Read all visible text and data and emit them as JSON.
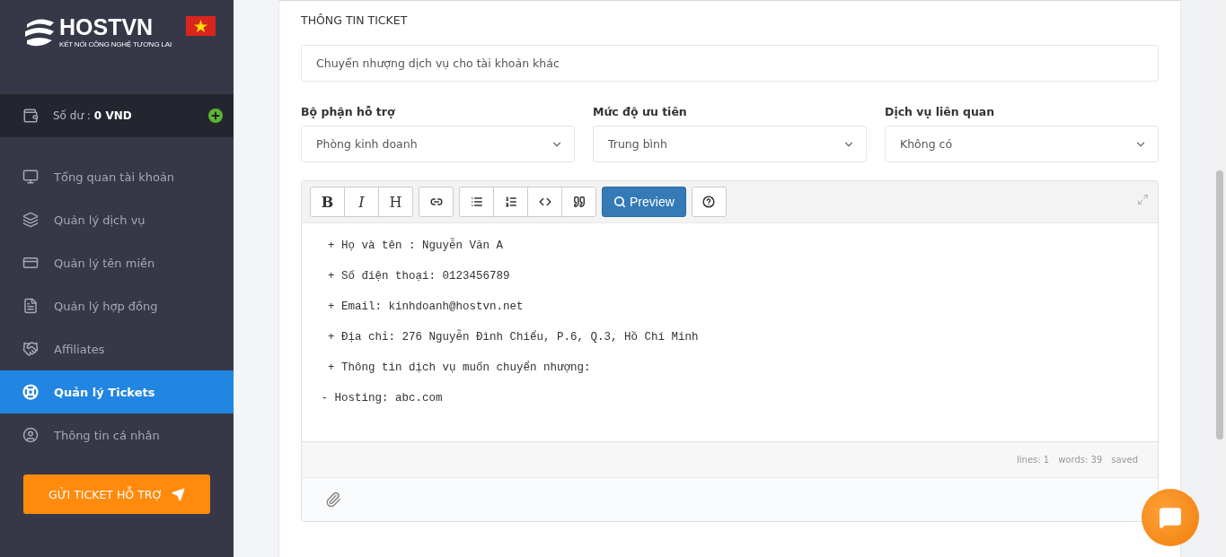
{
  "sidebar": {
    "logo": {
      "name": "HOSTVN",
      "tagline": "KẾT NỐI CÔNG NGHỆ TƯƠNG LAI"
    },
    "balance": {
      "label": "Số dư :",
      "value": "0 VND"
    },
    "items": [
      {
        "label": "Tổng quan tài khoản",
        "selected": false
      },
      {
        "label": "Quản lý dịch vụ",
        "selected": false
      },
      {
        "label": "Quản lý tên miền",
        "selected": false
      },
      {
        "label": "Quản lý hợp đồng",
        "selected": false
      },
      {
        "label": "Affiliates",
        "selected": false
      },
      {
        "label": "Quản lý Tickets",
        "selected": true
      },
      {
        "label": "Thông tin cá nhân",
        "selected": false
      }
    ],
    "cta": "GỬI TICKET HỖ TRỢ"
  },
  "form": {
    "section_title": "THÔNG TIN TICKET",
    "subject": "Chuyển nhượng dịch vụ cho tài khoản khác",
    "selects": [
      {
        "label": "Bộ phận hỗ trợ",
        "value": "Phòng kinh doanh"
      },
      {
        "label": "Mức độ ưu tiên",
        "value": "Trung bình"
      },
      {
        "label": "Dịch vụ liên quan",
        "value": "Không có"
      }
    ],
    "editor": {
      "toolbar": [
        [
          {
            "kind": "bold",
            "label": "B"
          },
          {
            "kind": "italic",
            "label": "I"
          },
          {
            "kind": "heading",
            "label": "H"
          }
        ],
        [
          {
            "kind": "link"
          }
        ],
        [
          {
            "kind": "bullets"
          },
          {
            "kind": "numbered"
          },
          {
            "kind": "code"
          },
          {
            "kind": "quote"
          }
        ],
        [
          {
            "kind": "preview",
            "label": "Preview"
          }
        ],
        [
          {
            "kind": "help"
          }
        ]
      ],
      "lines": [
        "  + Họ và tên : Nguyễn Văn A",
        "  + Số điện thoại: 0123456789",
        "  + Email: kinhdoanh@hostvn.net",
        "  + Địa chỉ: 276 Nguyễn Đình Chiểu, P.6, Q.3, Hồ Chí Minh",
        "  + Thông tin dịch vụ muốn chuyển nhượng:",
        " - Hosting: abc.com"
      ],
      "status": [
        "lines: 1",
        "words: 39",
        "saved"
      ]
    }
  }
}
